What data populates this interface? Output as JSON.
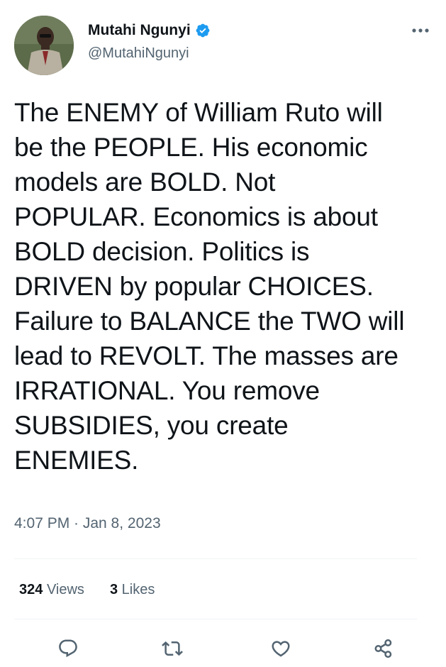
{
  "author": {
    "display_name": "Mutahi Ngunyi",
    "handle": "@MutahiNgunyi",
    "verified": true
  },
  "tweet": {
    "text": "The ENEMY of William Ruto will\nbe the PEOPLE. His economic\nmodels are BOLD. Not\nPOPULAR. Economics is about\nBOLD decision. Politics is\nDRIVEN by popular CHOICES.\nFailure to BALANCE the TWO will\nlead to REVOLT. The masses are\nIRRATIONAL. You remove\nSUBSIDIES, you create\nENEMIES.",
    "timestamp": "4:07 PM · Jan 8, 2023"
  },
  "stats": {
    "views_count": "324",
    "views_label": "Views",
    "likes_count": "3",
    "likes_label": "Likes"
  },
  "icons": {
    "more": "more-horizontal-icon",
    "reply": "reply-icon",
    "retweet": "retweet-icon",
    "like": "heart-icon",
    "share": "share-icon",
    "verified": "verified-badge-icon"
  },
  "colors": {
    "text_primary": "#0f1419",
    "text_secondary": "#536471",
    "verified_blue": "#1d9bf0",
    "divider": "#eff3f4"
  }
}
